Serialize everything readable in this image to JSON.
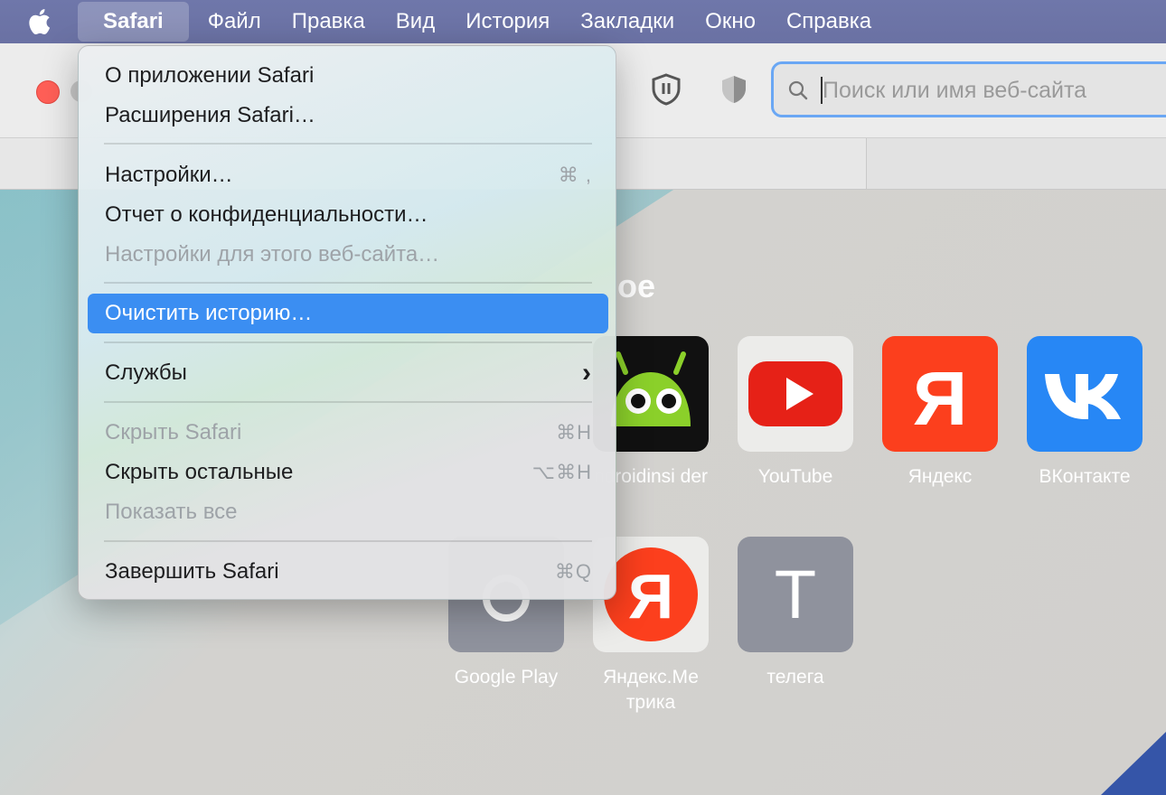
{
  "menubar": {
    "items": [
      "Safari",
      "Файл",
      "Правка",
      "Вид",
      "История",
      "Закладки",
      "Окно",
      "Справка"
    ]
  },
  "toolbar": {
    "search_placeholder": "Поиск или имя веб-сайта"
  },
  "favorites": {
    "title_visible": "ое",
    "tiles": [
      {
        "label": "ndroidinsi der"
      },
      {
        "label": "YouTube"
      },
      {
        "label": "Яндекс"
      },
      {
        "label": "ВКонтакте"
      },
      {
        "label": "Google Play"
      },
      {
        "label": "Яндекс.Ме трика"
      },
      {
        "label": "телега",
        "glyph": "Т"
      }
    ]
  },
  "safari_menu": {
    "items": [
      {
        "label": "О приложении Safari",
        "shortcut": ""
      },
      {
        "label": "Расширения Safari…",
        "shortcut": ""
      },
      {
        "label": "Настройки…",
        "shortcut": "⌘ ,"
      },
      {
        "label": "Отчет о конфиденциальности…",
        "shortcut": ""
      },
      {
        "label": "Настройки для этого веб-сайта…",
        "shortcut": "",
        "disabled": true
      },
      {
        "label": "Очистить историю…",
        "shortcut": "",
        "highlighted": true
      },
      {
        "label": "Службы",
        "shortcut": "›"
      },
      {
        "label": "Скрыть Safari",
        "shortcut": "⌘H",
        "disabled": true
      },
      {
        "label": "Скрыть остальные",
        "shortcut": "⌥⌘H"
      },
      {
        "label": "Показать все",
        "shortcut": "",
        "disabled": true
      },
      {
        "label": "Завершить Safari",
        "shortcut": "⌘Q"
      }
    ]
  },
  "colors": {
    "menubar": "#6f77aa",
    "highlight": "#3b8ef2",
    "youtube_red": "#e62117",
    "yandex_red": "#fc3f1d",
    "vk_blue": "#2787f5"
  }
}
